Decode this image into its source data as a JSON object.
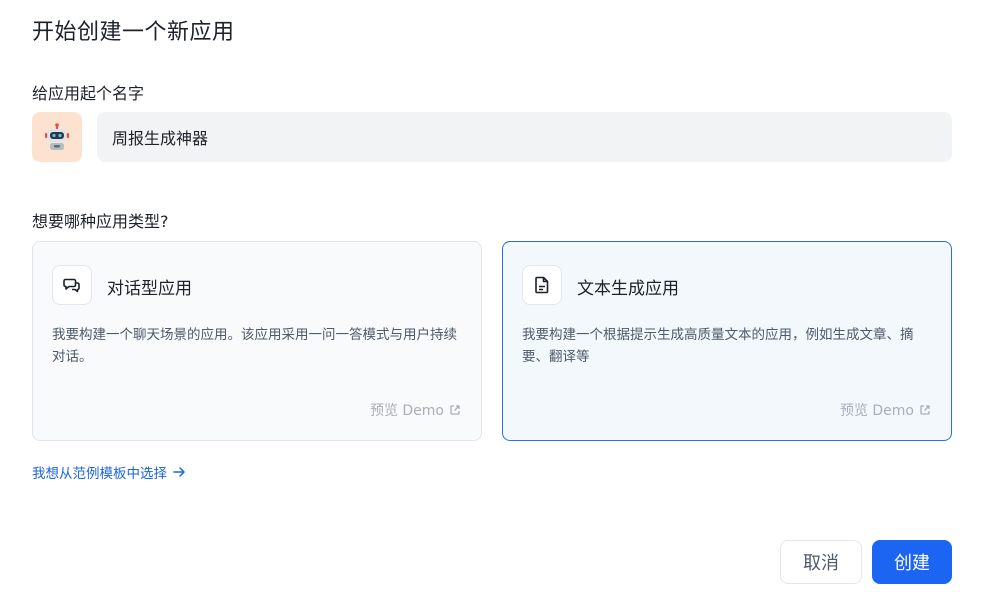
{
  "page": {
    "title": "开始创建一个新应用"
  },
  "app_name": {
    "label": "给应用起个名字",
    "value": "周报生成神器",
    "icon": "robot-icon",
    "icon_bg": "#fde3cf"
  },
  "app_type": {
    "label": "想要哪种应用类型?",
    "options": [
      {
        "title": "对话型应用",
        "description": "我要构建一个聊天场景的应用。该应用采用一问一答模式与用户持续对话。",
        "preview": "预览 Demo",
        "icon": "chat-bubbles-icon",
        "selected": false
      },
      {
        "title": "文本生成应用",
        "description": "我要构建一个根据提示生成高质量文本的应用，例如生成文章、摘要、翻译等",
        "preview": "预览 Demo",
        "icon": "document-icon",
        "selected": true
      }
    ]
  },
  "template_link": "我想从范例模板中选择",
  "actions": {
    "cancel": "取消",
    "create": "创建"
  },
  "colors": {
    "accent": "#1c64f2",
    "selected_border": "#2a6ee0"
  }
}
